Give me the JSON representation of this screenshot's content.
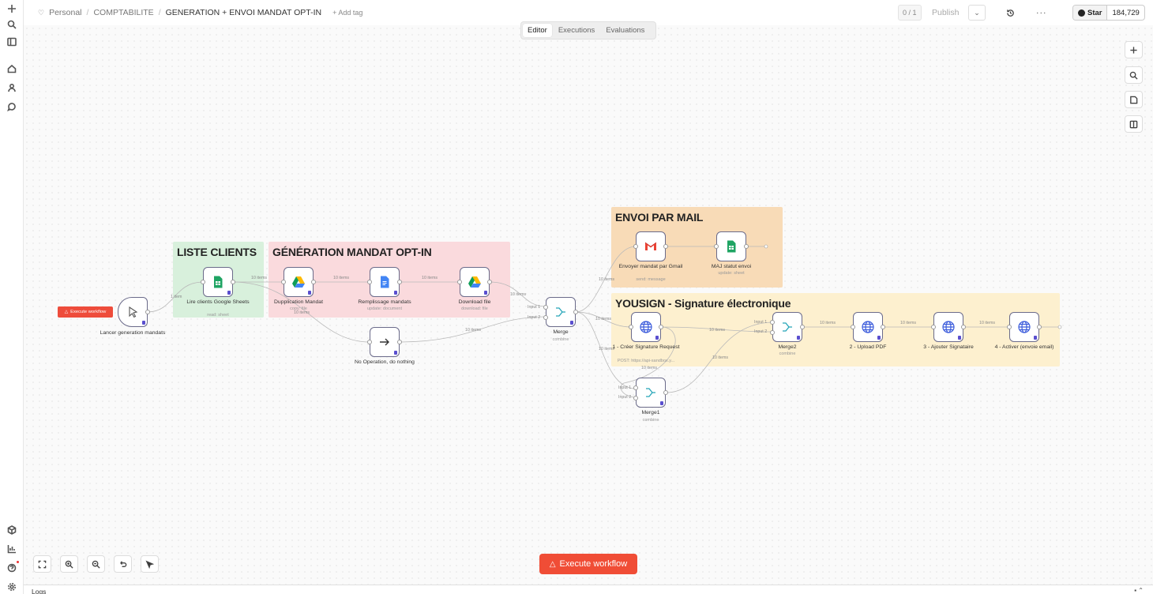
{
  "breadcrumb": {
    "project": "Personal",
    "folder": "COMPTABILITE",
    "workflow": "GENERATION + ENVOI MANDAT OPT-IN",
    "add_tag": "+ Add tag"
  },
  "header": {
    "counter": "0 / 1",
    "publish": "Publish",
    "github_star": "Star",
    "github_count": "184,729"
  },
  "view_tabs": [
    "Editor",
    "Executions",
    "Evaluations"
  ],
  "active_tab": "Editor",
  "stickies": {
    "liste_clients": "LISTE CLIENTS",
    "generation": "GÉNÉRATION MANDAT OPT-IN",
    "envoi": "ENVOI PAR MAIL",
    "yousign": "YOUSIGN - Signature électronique"
  },
  "nodes": {
    "trigger": {
      "label": "Lancer generation mandats",
      "sub": ""
    },
    "sheets_read": {
      "label": "Lire clients Google Sheets",
      "sub": "read: sheet"
    },
    "dup": {
      "label": "Dupplication Mandat",
      "sub": "copy: file"
    },
    "fill": {
      "label": "Remplissage mandats",
      "sub": "update: document"
    },
    "download": {
      "label": "Download file",
      "sub": "download: file"
    },
    "noop": {
      "label": "No Operation, do nothing",
      "sub": ""
    },
    "merge": {
      "label": "Merge",
      "sub": "combine"
    },
    "gmail": {
      "label": "Envoyer mandat par Gmail",
      "sub": "send: message"
    },
    "maj": {
      "label": "MAJ statut envoi",
      "sub": "update: sheet"
    },
    "create_sig": {
      "label": "1 - Créer Signature Request",
      "sub": "POST: https://api-sandbox.y..."
    },
    "merge2": {
      "label": "Merge2",
      "sub": "combine"
    },
    "upload": {
      "label": "2 - Upload PDF",
      "sub": ""
    },
    "signer": {
      "label": "3 - Ajouter Signataire",
      "sub": ""
    },
    "activate": {
      "label": "4 - Activer (envoie email)",
      "sub": ""
    },
    "merge1": {
      "label": "Merge1",
      "sub": "combine"
    }
  },
  "edge_labels": {
    "one_item": "1 item",
    "ten_items": "10 items",
    "input1": "Input 1",
    "input2": "Input 2"
  },
  "execute_small": "Execute workflow",
  "execute_main": "Execute workflow",
  "logs": "Logs",
  "colors": {
    "execute": "#f04d36",
    "sticky_green": "#d8f0dc",
    "sticky_pink": "#fadadd",
    "sticky_orange": "#f8dbb7",
    "sticky_yellow": "#fdf0cf",
    "node_border": "#6b6b8a"
  },
  "icons": {
    "sidebar": [
      "plus-icon",
      "search-icon",
      "panel-icon",
      "home-icon",
      "user-icon",
      "chat-icon",
      "cube-icon",
      "chart-icon",
      "help-icon",
      "gear-icon"
    ],
    "canvas_right": [
      "plus-icon",
      "search-icon",
      "sticky-icon",
      "panel-icon"
    ],
    "canvas_bottom": [
      "fit-view-icon",
      "zoom-in-icon",
      "zoom-out-icon",
      "undo-icon",
      "cursor-icon"
    ]
  }
}
